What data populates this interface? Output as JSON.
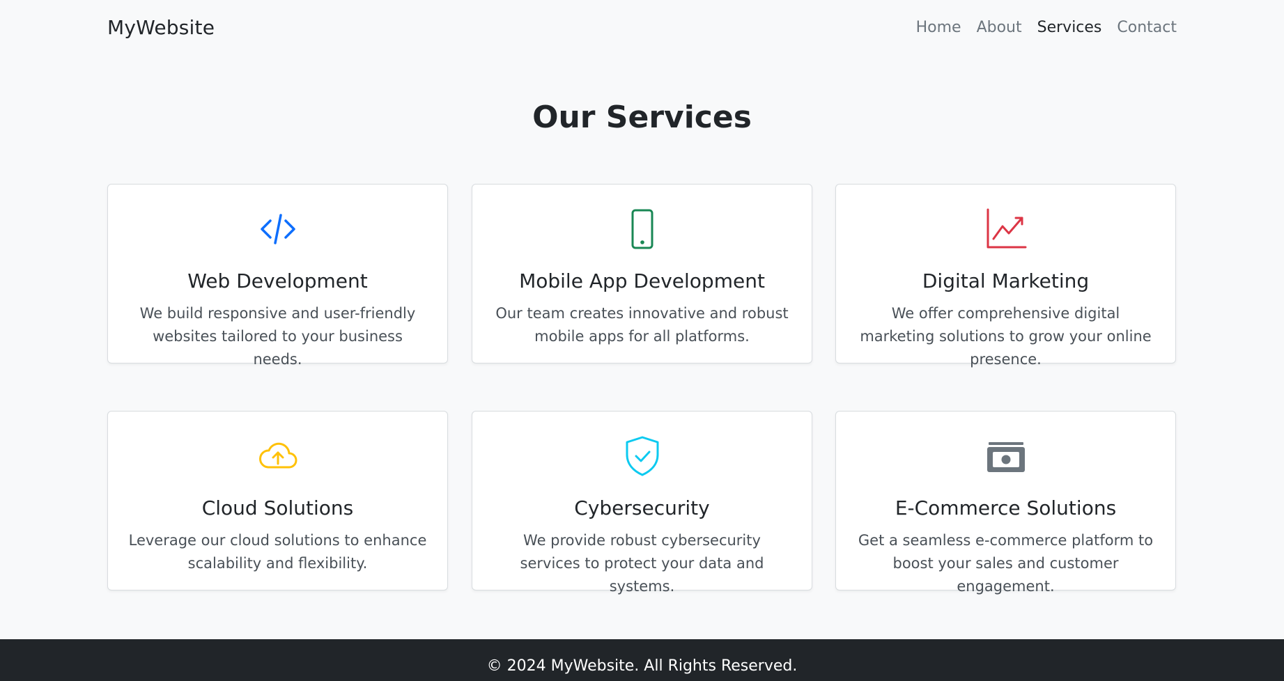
{
  "brand": "MyWebsite",
  "nav": {
    "home": "Home",
    "about": "About",
    "services": "Services",
    "contact": "Contact"
  },
  "page_title": "Our Services",
  "services": [
    {
      "icon": "code-icon",
      "color": "#0d6efd",
      "title": "Web Development",
      "description": "We build responsive and user-friendly websites tailored to your business needs."
    },
    {
      "icon": "phone-icon",
      "color": "#198754",
      "title": "Mobile App Development",
      "description": "Our team creates innovative and robust mobile apps for all platforms."
    },
    {
      "icon": "graph-up-icon",
      "color": "#dc3545",
      "title": "Digital Marketing",
      "description": "We offer comprehensive digital marketing solutions to grow your online presence."
    },
    {
      "icon": "cloud-upload-icon",
      "color": "#ffc107",
      "title": "Cloud Solutions",
      "description": "Leverage our cloud solutions to enhance scalability and flexibility."
    },
    {
      "icon": "shield-check-icon",
      "color": "#0dcaf0",
      "title": "Cybersecurity",
      "description": "We provide robust cybersecurity services to protect your data and systems."
    },
    {
      "icon": "cash-icon",
      "color": "#6c757d",
      "title": "E-Commerce Solutions",
      "description": "Get a seamless e-commerce platform to boost your sales and customer engagement."
    }
  ],
  "footer": "© 2024 MyWebsite. All Rights Reserved."
}
